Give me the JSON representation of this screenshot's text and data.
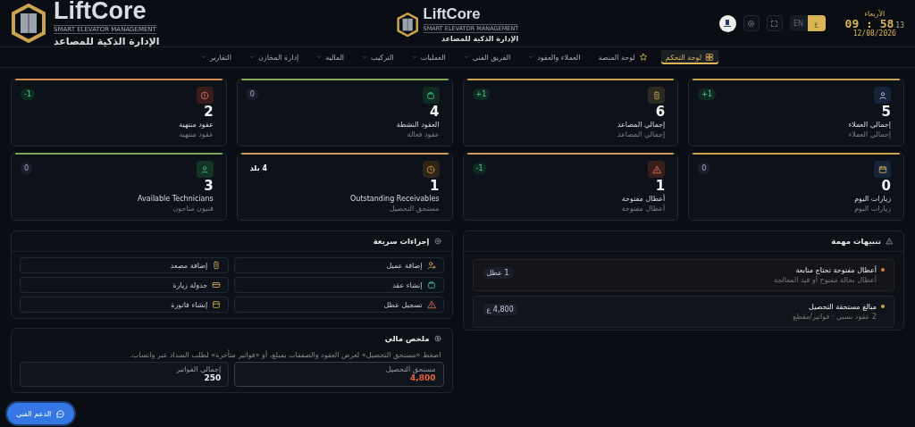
{
  "header": {
    "brand": {
      "name": "LiftCore",
      "tagline": "SMART ELEVATOR MANAGEMENT",
      "subtitle": "الإدارة الذكية للمصاعد"
    },
    "center_brand": {
      "name": "LiftCore",
      "tagline": "SMART ELEVATOR MANAGEMENT",
      "subtitle": "الإدارة الذكية للمصاعد"
    },
    "clock": {
      "day": "الأربعاء",
      "time": "09 : 58",
      "seconds": "13",
      "date": "12/08/2026"
    },
    "languages": [
      {
        "label": "ع",
        "selected": true
      },
      {
        "label": "EN",
        "selected": false
      }
    ]
  },
  "nav": {
    "tabs": [
      {
        "label": "لوحة التحكم",
        "kind": "grid",
        "selected": true
      },
      {
        "label": "لوحة المنصة",
        "kind": "star",
        "selected": false
      },
      {
        "label": "العملاء والعقود",
        "kind": "menu",
        "selected": false
      },
      {
        "label": "الفريق الفني",
        "kind": "menu",
        "selected": false
      },
      {
        "label": "العمليات",
        "kind": "menu",
        "selected": false
      },
      {
        "label": "التركيب",
        "kind": "menu",
        "selected": false
      },
      {
        "label": "المالية",
        "kind": "menu",
        "selected": false
      },
      {
        "label": "إدارة المخازن",
        "kind": "menu",
        "selected": false
      },
      {
        "label": "التقارير",
        "kind": "menu",
        "selected": false
      }
    ]
  },
  "stats": [
    {
      "value": "5",
      "label": "إجمالي العملاء",
      "sublabel": "إجمالي العملاء",
      "badge": {
        "text": "1+",
        "kind": "change"
      },
      "kind": "user",
      "color": "#c9a44e"
    },
    {
      "value": "6",
      "label": "إجمالي المصاعد",
      "sublabel": "إجمالي المصاعد",
      "badge": {
        "text": "1+",
        "kind": "change"
      },
      "kind": "elevator",
      "color": "#c9a44e"
    },
    {
      "value": "4",
      "label": "العقود النشطة",
      "sublabel": "عقود فعالة",
      "badge": {
        "text": "0",
        "kind": "neutral"
      },
      "kind": "bag",
      "color": "#7fa65a"
    },
    {
      "value": "2",
      "label": "عقود منتهية",
      "sublabel": "عقود منتهية",
      "badge": {
        "text": "1-",
        "kind": "change"
      },
      "kind": "alert",
      "color": "#d08a4a"
    },
    {
      "value": "0",
      "label": "زيارات اليوم",
      "sublabel": "زيارات اليوم",
      "badge": {
        "text": "0",
        "kind": "neutral"
      },
      "kind": "calendar",
      "color": "#c9a44e"
    },
    {
      "value": "1",
      "label": "أعطال مفتوحة",
      "sublabel": "أعطال مفتوحة",
      "badge": {
        "text": "1-",
        "kind": "change"
      },
      "kind": "warning",
      "color": "#d09a5a"
    },
    {
      "value": "1",
      "label": "Outstanding Receivables",
      "sublabel": "مستحق التحصيل",
      "badge": {
        "text": "4 بلد",
        "kind": "plain"
      },
      "kind": "clock",
      "color": "#d09a5a"
    },
    {
      "value": "3",
      "label": "Available Technicians",
      "sublabel": "فنيون متاحون",
      "badge": {
        "text": "0",
        "kind": "neutral"
      },
      "kind": "tech",
      "color": "#7fa65a"
    }
  ],
  "alerts": {
    "title": "تنبيهات مهمة",
    "items": [
      {
        "title": "أعطال مفتوحة تحتاج متابعة",
        "subtitle": "أعطال بحالة مفتوح أو قيد المعالجة",
        "badge": "1 عطل",
        "color": "#e07a4a"
      },
      {
        "title": "مبالغ مستحقة التحصيل",
        "subtitle": "2 عقود نسبي · فواتير/مقطع",
        "badge": "4,800 ع",
        "color": "#d9a441"
      }
    ]
  },
  "quick_actions": {
    "title": "إجراءات سريعة",
    "items": [
      {
        "label": "إضافة عميل",
        "kind": "user-add"
      },
      {
        "label": "إضافة مصعد",
        "kind": "elevator"
      },
      {
        "label": "إنشاء عقد",
        "kind": "bag"
      },
      {
        "label": "جدولة زيارة",
        "kind": "card"
      },
      {
        "label": "تسجيل عطل",
        "kind": "warning"
      },
      {
        "label": "إنشاء فاتورة",
        "kind": "invoice"
      }
    ]
  },
  "financial": {
    "title": "ملخص مالي",
    "description": "اضغط «مستحق التحصيل» لعرض العقود والصفقات بمبلغ، أو «فواتير متأخرة» لطلب السداد عبر واتساب.",
    "cards": [
      {
        "label": "مستحق التحصيل",
        "value": "4,800",
        "kind": "due"
      },
      {
        "label": "إجمالي الفواتير",
        "value": "250",
        "kind": "total"
      }
    ]
  },
  "support_button": {
    "label": "الدعم الفني"
  }
}
